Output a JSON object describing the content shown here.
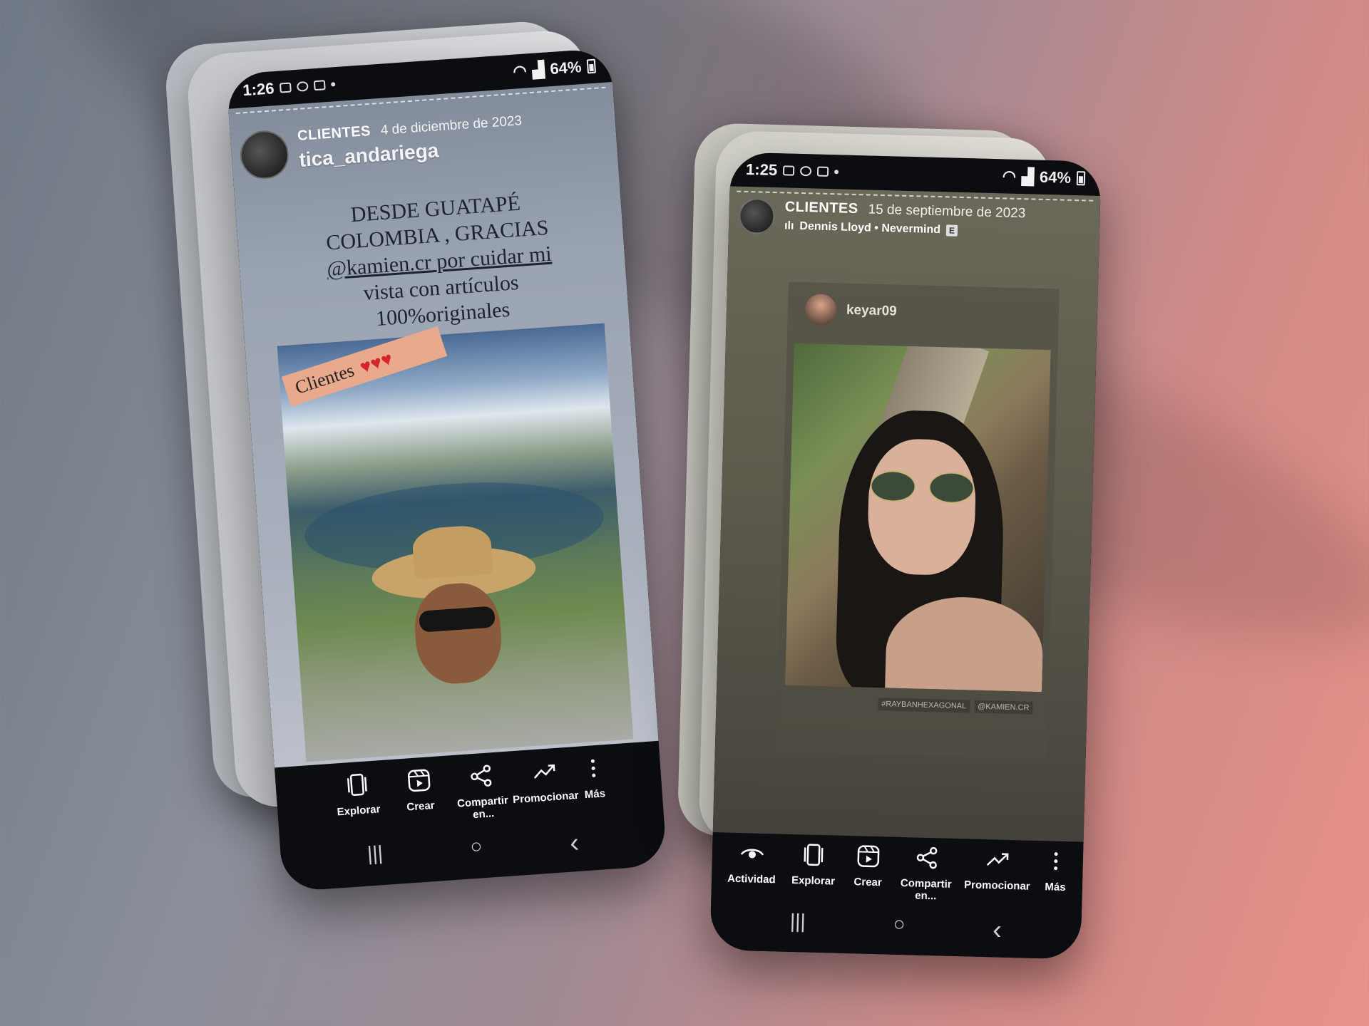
{
  "left_phone": {
    "status": {
      "time": "1:26",
      "battery": "64%"
    },
    "highlight_title": "CLIENTES",
    "highlight_date": "4 de diciembre de 2023",
    "username": "tica_andariega",
    "caption_lines": [
      "DESDE GUATAPÉ",
      "COLOMBIA , GRACIAS",
      "@kamien.cr por cuidar mi",
      "vista con artículos",
      "100%originales"
    ],
    "sticker": "Clientes",
    "actions": [
      {
        "label": "Explorar",
        "icon": "explore-icon"
      },
      {
        "label": "Crear",
        "icon": "reels-icon"
      },
      {
        "label": "Compartir en...",
        "icon": "share-icon"
      },
      {
        "label": "Promocionar",
        "icon": "trend-icon"
      },
      {
        "label": "Más",
        "icon": "more-icon"
      }
    ]
  },
  "right_phone": {
    "status": {
      "time": "1:25",
      "battery": "64%"
    },
    "highlight_title": "CLIENTES",
    "highlight_date": "15 de septiembre de 2023",
    "music": "Dennis Lloyd • Nevermind",
    "explicit_badge": "E",
    "shared_user": "keyar09",
    "tags": [
      "#RAYBANHEXAGONAL",
      "@KAMIEN.CR"
    ],
    "actions": [
      {
        "label": "Actividad",
        "icon": "eye-icon"
      },
      {
        "label": "Explorar",
        "icon": "explore-icon"
      },
      {
        "label": "Crear",
        "icon": "reels-icon"
      },
      {
        "label": "Compartir en...",
        "icon": "share-icon"
      },
      {
        "label": "Promocionar",
        "icon": "trend-icon"
      },
      {
        "label": "Más",
        "icon": "more-icon"
      }
    ]
  },
  "nav": {
    "recents": "|||",
    "home": "○",
    "back": "‹"
  }
}
